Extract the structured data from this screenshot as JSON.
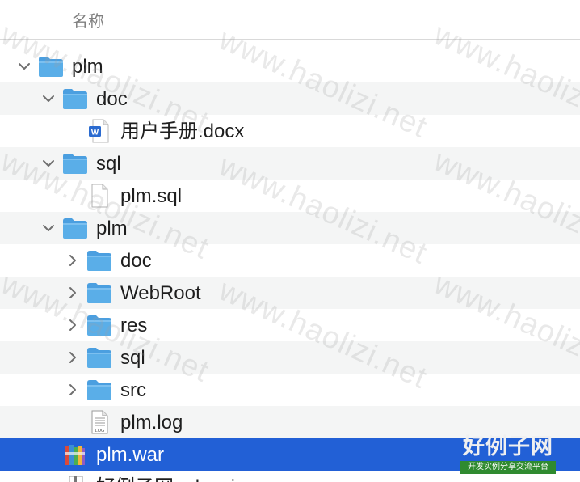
{
  "header": {
    "column_name": "名称"
  },
  "tree": [
    {
      "label": "plm",
      "type": "folder",
      "expanded": true
    },
    {
      "label": "doc",
      "type": "folder",
      "expanded": true
    },
    {
      "label": "用户手册.docx",
      "type": "docx"
    },
    {
      "label": "sql",
      "type": "folder",
      "expanded": true
    },
    {
      "label": "plm.sql",
      "type": "file"
    },
    {
      "label": "plm",
      "type": "folder",
      "expanded": true
    },
    {
      "label": "doc",
      "type": "folder",
      "expanded": false
    },
    {
      "label": "WebRoot",
      "type": "folder",
      "expanded": false
    },
    {
      "label": "res",
      "type": "folder",
      "expanded": false
    },
    {
      "label": "sql",
      "type": "folder",
      "expanded": false
    },
    {
      "label": "src",
      "type": "folder",
      "expanded": false
    },
    {
      "label": "plm.log",
      "type": "log"
    },
    {
      "label": "plm.war",
      "type": "war",
      "selected": true
    },
    {
      "label": "好例子网_plm.zip",
      "type": "zip"
    }
  ],
  "watermark": {
    "text": "www.haolizi.net"
  },
  "logo": {
    "main": "好例子网",
    "sub": "开发实例分享交流平台"
  },
  "colors": {
    "selection": "#2260d6",
    "folder": "#5aaee8",
    "alt_row": "#f4f5f5"
  }
}
